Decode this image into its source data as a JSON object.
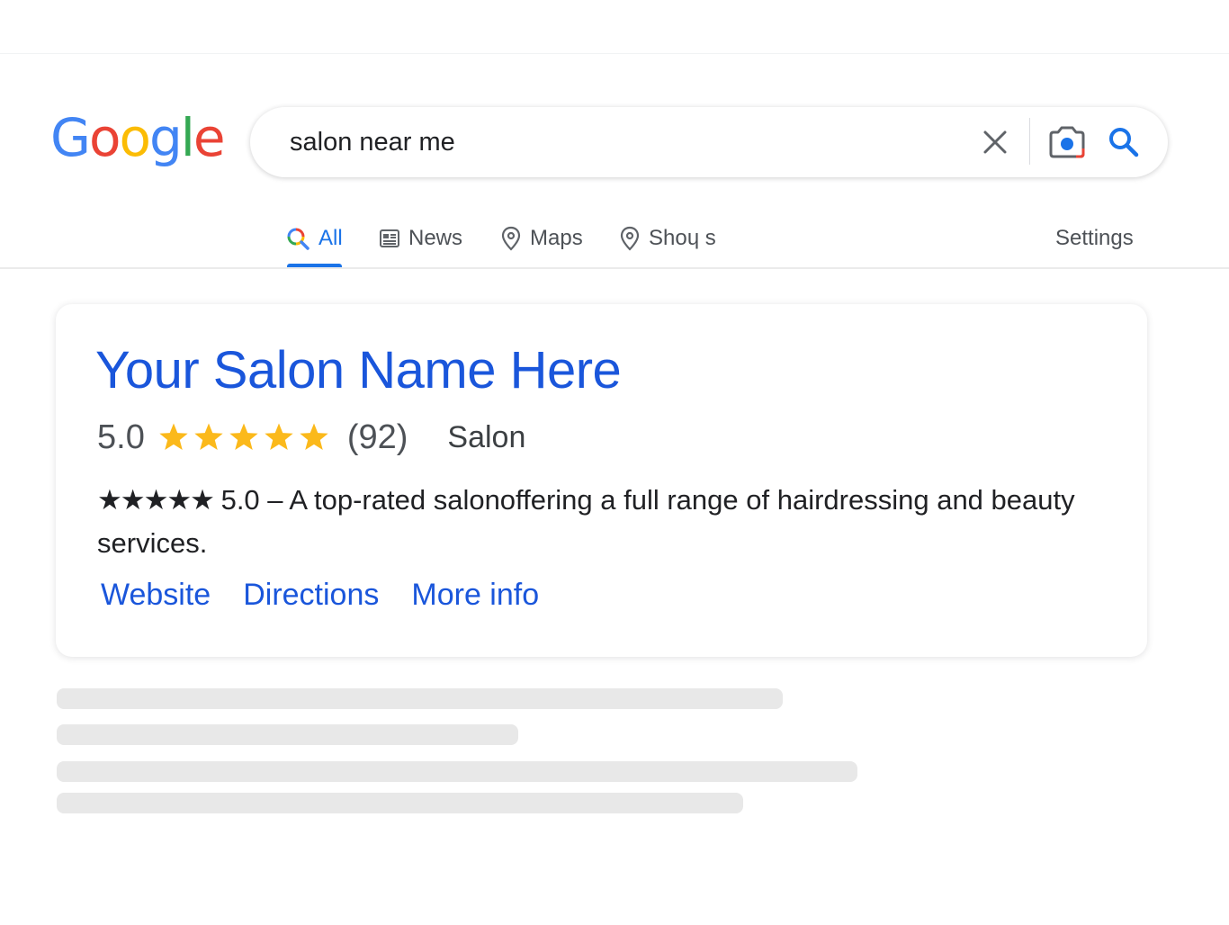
{
  "logo": {
    "text": "Google",
    "letters": [
      "G",
      "o",
      "o",
      "g",
      "l",
      "e"
    ],
    "colors": [
      "#4285F4",
      "#EA4335",
      "#FBBC05",
      "#4285F4",
      "#34A853",
      "#EA4335"
    ]
  },
  "search": {
    "value": "salon near me",
    "placeholder": ""
  },
  "tabs": [
    {
      "label": "All",
      "icon": "search-multicolor-icon",
      "active": true
    },
    {
      "label": "News",
      "icon": "news-icon",
      "active": false
    },
    {
      "label": "Maps",
      "icon": "map-pin-icon",
      "active": false
    },
    {
      "label": "Shoɥ s",
      "icon": "map-pin-icon",
      "active": false
    }
  ],
  "settings_label": "Settings",
  "result": {
    "title": "Your Salon Name Here",
    "rating": "5.0",
    "stars": 5,
    "review_count": "(92)",
    "category": "Salon",
    "description_stars": "★★★★★",
    "description": " 5.0 – A top-rated salonoffering a full range of hairdressing and beauty services.",
    "links": [
      "Website",
      "Directions",
      "More info"
    ]
  },
  "colors": {
    "link": "#1a56db",
    "star": "#FBB91B",
    "accent": "#1a73e8"
  }
}
